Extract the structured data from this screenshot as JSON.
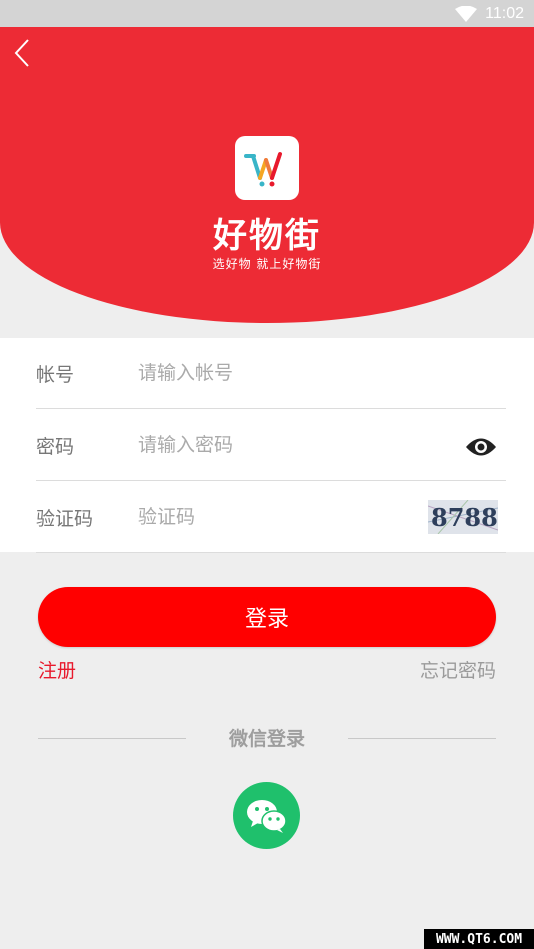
{
  "status_bar": {
    "time": "11:02",
    "wifi_icon": "wifi-icon"
  },
  "header": {
    "back_icon": "chevron-left-icon",
    "brand_name": "好物街",
    "slogan": "选好物 就上好物街"
  },
  "form": {
    "account": {
      "label": "帐号",
      "placeholder": "请输入帐号",
      "value": ""
    },
    "password": {
      "label": "密码",
      "placeholder": "请输入密码",
      "value": "",
      "toggle_icon": "eye-icon"
    },
    "captcha": {
      "label": "验证码",
      "placeholder": "验证码",
      "value": "",
      "code": "8788"
    }
  },
  "actions": {
    "login_label": "登录",
    "register_label": "注册",
    "forgot_label": "忘记密码"
  },
  "wechat": {
    "title": "微信登录",
    "icon": "wechat-icon"
  },
  "watermark": "WWW.QT6.COM",
  "colors": {
    "brand_red": "#ed2b35",
    "button_red": "#ff0000",
    "register_red": "#e8192c",
    "wechat_green": "#1fc06c"
  }
}
